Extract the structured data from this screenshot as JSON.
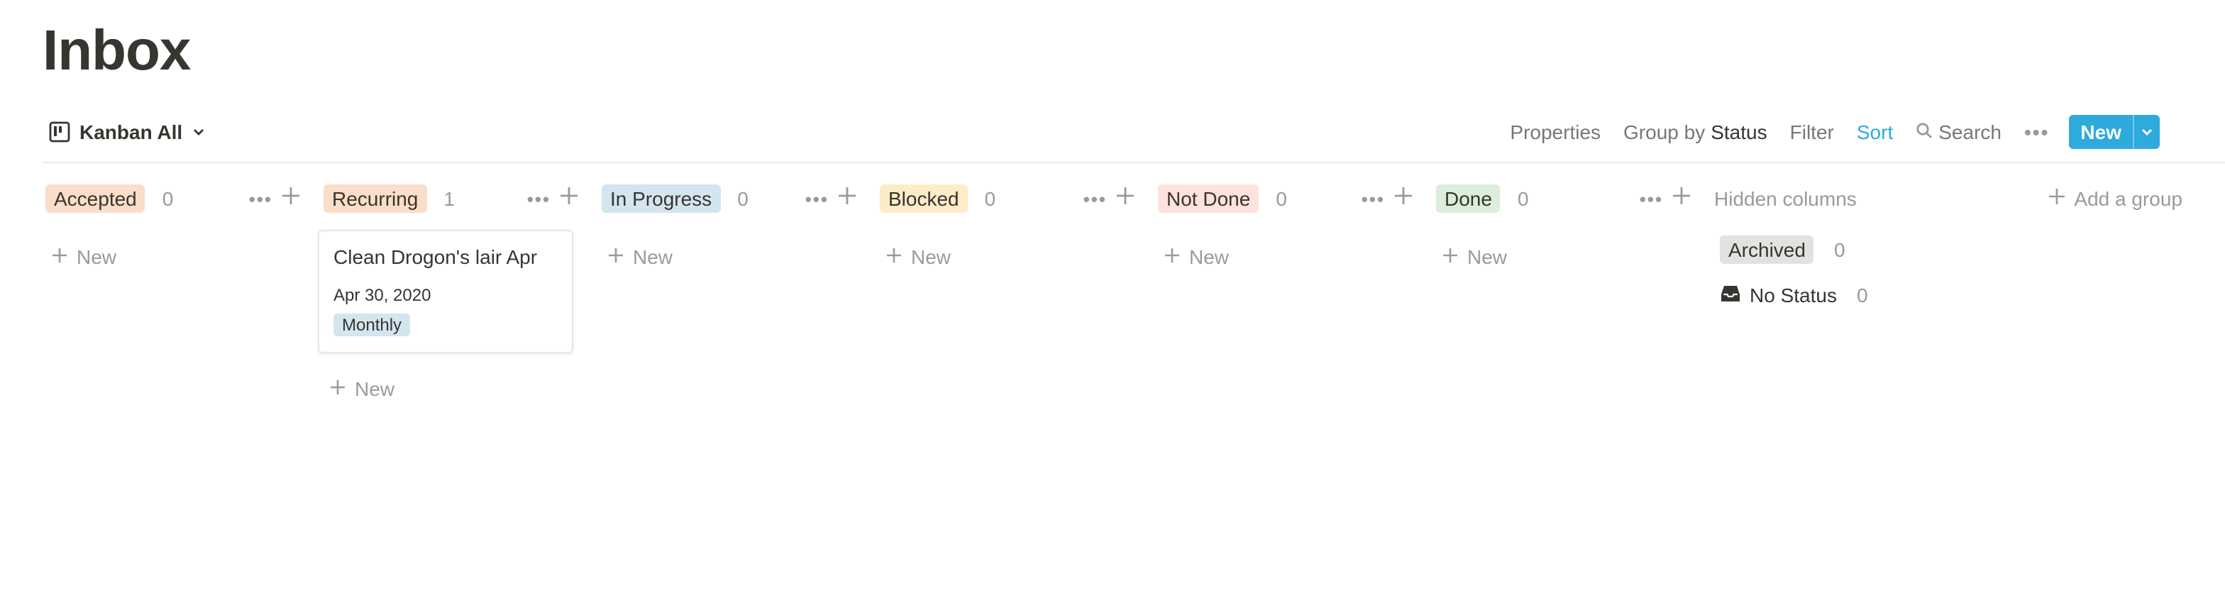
{
  "page": {
    "title": "Inbox"
  },
  "view": {
    "label": "Kanban All",
    "icon": "board-icon"
  },
  "toolbar": {
    "properties": "Properties",
    "group_by_prefix": "Group by",
    "group_by_value": "Status",
    "filter": "Filter",
    "sort": "Sort",
    "search": "Search",
    "more": "•••",
    "new_label": "New"
  },
  "columns": [
    {
      "label": "Accepted",
      "count": "0",
      "color": "#fadec9"
    },
    {
      "label": "Recurring",
      "count": "1",
      "color": "#fadec9"
    },
    {
      "label": "In Progress",
      "count": "0",
      "color": "#d3e5ef"
    },
    {
      "label": "Blocked",
      "count": "0",
      "color": "#fdecc8"
    },
    {
      "label": "Not Done",
      "count": "0",
      "color": "#ffe2dd"
    },
    {
      "label": "Done",
      "count": "0",
      "color": "#dbeddb"
    }
  ],
  "column_tools": {
    "more": "•••"
  },
  "new_row_label": "New",
  "card": {
    "title": "Clean Drogon's lair Apr",
    "date": "Apr 30, 2020",
    "tag": "Monthly",
    "tag_color": "#d3e5ef"
  },
  "hidden": {
    "header": "Hidden columns",
    "add_group": "Add a group",
    "items": [
      {
        "label": "Archived",
        "count": "0"
      },
      {
        "label": "No Status",
        "count": "0",
        "icon": "inbox-icon"
      }
    ]
  }
}
